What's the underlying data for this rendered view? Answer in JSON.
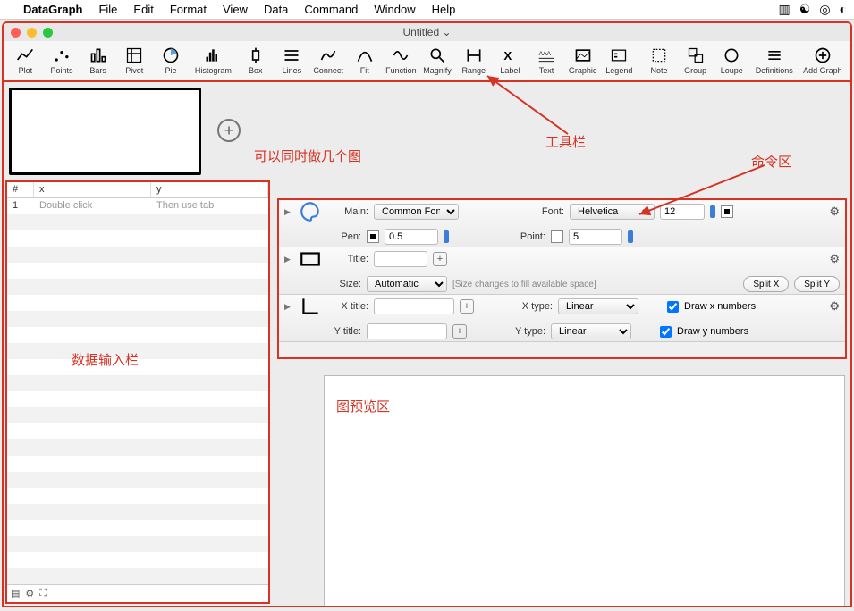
{
  "menubar": {
    "app": "DataGraph",
    "items": [
      "File",
      "Edit",
      "Format",
      "View",
      "Data",
      "Command",
      "Window",
      "Help"
    ]
  },
  "window": {
    "title": "Untitled ⌄"
  },
  "toolbar": {
    "items": [
      {
        "id": "plot",
        "label": "Plot"
      },
      {
        "id": "points",
        "label": "Points"
      },
      {
        "id": "bars",
        "label": "Bars"
      },
      {
        "id": "pivot",
        "label": "Pivot"
      },
      {
        "id": "pie",
        "label": "Pie"
      },
      {
        "id": "histogram",
        "label": "Histogram"
      },
      {
        "id": "box",
        "label": "Box"
      },
      {
        "id": "lines",
        "label": "Lines"
      },
      {
        "id": "connect",
        "label": "Connect"
      },
      {
        "id": "fit",
        "label": "Fit"
      },
      {
        "id": "function",
        "label": "Function"
      },
      {
        "id": "magnify",
        "label": "Magnify"
      },
      {
        "id": "range",
        "label": "Range"
      },
      {
        "id": "label",
        "label": "Label"
      },
      {
        "id": "text",
        "label": "Text"
      },
      {
        "id": "graphic",
        "label": "Graphic"
      },
      {
        "id": "legend",
        "label": "Legend"
      }
    ],
    "right_items": [
      {
        "id": "note",
        "label": "Note"
      },
      {
        "id": "group",
        "label": "Group"
      },
      {
        "id": "loupe",
        "label": "Loupe"
      },
      {
        "id": "definitions",
        "label": "Definitions"
      },
      {
        "id": "addgraph",
        "label": "Add Graph"
      }
    ]
  },
  "annotations": {
    "toolbar_label": "工具栏",
    "command_label": "命令区",
    "addgraph_note": "可以同时做几个图",
    "data_label": "数据输入栏",
    "preview_label": "图预览区"
  },
  "datatable": {
    "headers": {
      "num": "#",
      "x": "x",
      "y": "y"
    },
    "first_row": {
      "num": "1",
      "x": "Double click",
      "y": "Then use tab"
    }
  },
  "cmd": {
    "main": {
      "label": "Main:",
      "value": "Common Font"
    },
    "font": {
      "label": "Font:",
      "value": "Helvetica",
      "size": "12"
    },
    "pen": {
      "label": "Pen:",
      "value": "0.5"
    },
    "point": {
      "label": "Point:",
      "value": "5"
    },
    "title": {
      "label": "Title:",
      "value": ""
    },
    "size": {
      "label": "Size:",
      "value": "Automatic",
      "hint": "[Size changes to fill available space]"
    },
    "splitx": "Split X",
    "splity": "Split Y",
    "xtitle": {
      "label": "X title:",
      "value": ""
    },
    "ytitle": {
      "label": "Y title:",
      "value": ""
    },
    "xtype": {
      "label": "X type:",
      "value": "Linear"
    },
    "ytype": {
      "label": "Y type:",
      "value": "Linear"
    },
    "drawx": "Draw x numbers",
    "drawy": "Draw y numbers"
  }
}
